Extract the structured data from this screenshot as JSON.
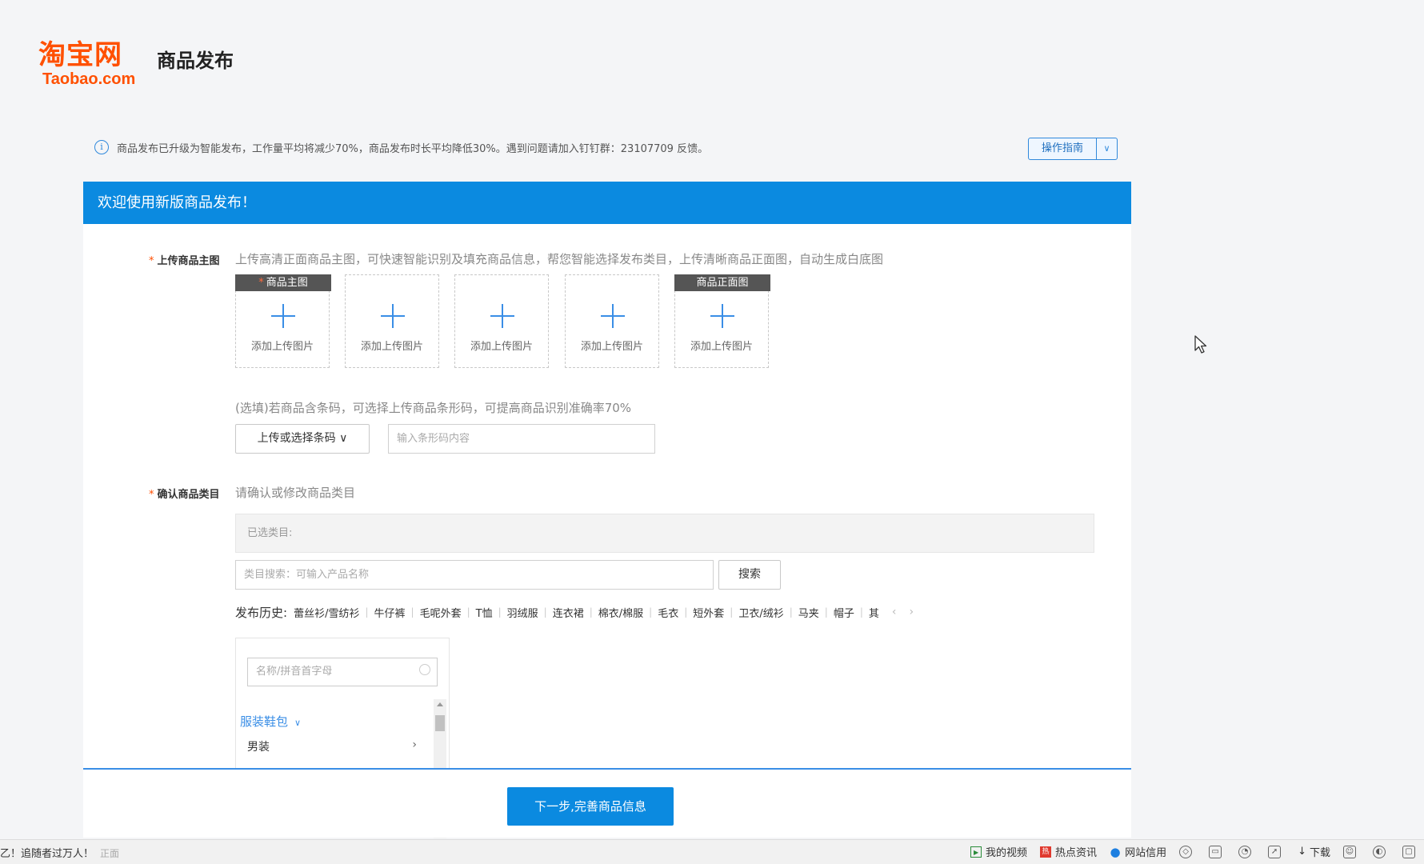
{
  "header": {
    "logo_cn": "淘宝网",
    "logo_en": "Taobao.com",
    "title": "商品发布"
  },
  "notice": {
    "icon": "info-icon",
    "text": "商品发布已升级为智能发布，工作量平均将减少70%，商品发布时长平均降低30%。遇到问题请加入钉钉群：23107709 反馈。",
    "guide_label": "操作指南",
    "guide_arrow": "∨"
  },
  "banner": {
    "text": "欢迎使用新版商品发布！"
  },
  "upload": {
    "required_mark": "*",
    "label": "上传商品主图",
    "hint": "上传高清正面商品主图，可快速智能识别及填充商品信息，帮您智能选择发布类目，上传清晰商品正面图，自动生成白底图",
    "slots": [
      {
        "tag": "商品主图",
        "required": "*",
        "text": "添加上传图片"
      },
      {
        "tag": "",
        "required": "",
        "text": "添加上传图片"
      },
      {
        "tag": "",
        "required": "",
        "text": "添加上传图片"
      },
      {
        "tag": "",
        "required": "",
        "text": "添加上传图片"
      },
      {
        "tag": "商品正面图",
        "required": "",
        "text": "添加上传图片"
      }
    ]
  },
  "barcode": {
    "hint": "(选填)若商品含条码，可选择上传商品条形码，可提高商品识别准确率70%",
    "button_label": "上传或选择条码 ∨",
    "input_placeholder": "输入条形码内容"
  },
  "category": {
    "required_mark": "*",
    "label": "确认商品类目",
    "hint": "请确认或修改商品类目",
    "selected_label": "已选类目:",
    "search_placeholder": "类目搜索：可输入产品名称",
    "search_button": "搜索",
    "history_title": "发布历史:",
    "history": [
      "蕾丝衫/雪纺衫",
      "牛仔裤",
      "毛呢外套",
      "T恤",
      "羽绒服",
      "连衣裙",
      "棉衣/棉服",
      "毛衣",
      "短外套",
      "卫衣/绒衫",
      "马夹",
      "帽子",
      "其"
    ],
    "history_prev": "‹",
    "history_next": "›",
    "filter_placeholder": "名称/拼音首字母",
    "group_label": "服装鞋包",
    "group_chevron": "∨",
    "item_label": "男装",
    "item_arrow": "›"
  },
  "footer": {
    "next_button": "下一步,完善商品信息"
  },
  "taskbar": {
    "left_text": "乙！追随者过万人！",
    "left_faded": "正面",
    "items": [
      {
        "icon": "video-icon",
        "glyph": "▶",
        "label": "我的视频"
      },
      {
        "icon": "news-icon",
        "glyph": "热",
        "label": "热点资讯"
      },
      {
        "icon": "drop-icon",
        "glyph": "●",
        "label": "网站信用"
      }
    ],
    "download_glyph": "↓",
    "download_label": "下载"
  },
  "colors": {
    "brand_orange": "#ff5000",
    "primary_blue": "#0b8ae0",
    "link_blue": "#3a8ee6",
    "required_red": "#ff4d00"
  }
}
